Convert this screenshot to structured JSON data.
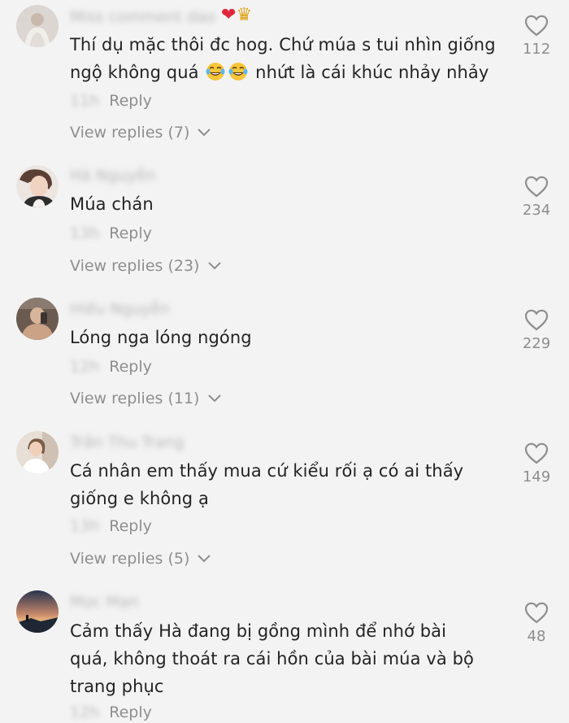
{
  "comments": [
    {
      "username": "Miss comment dao",
      "badges": {
        "heart": "❤",
        "crown": "♛"
      },
      "text_line1": "Thí dụ mặc thôi đc hog. Chứ múa s tui nhìn giống",
      "text_line2_before": "ngộ không quá",
      "text_line2_after": "nhứt là cái khúc nhảy nhảy",
      "emoji": "tears-of-joy",
      "timestamp": "11h",
      "reply_label": "Reply",
      "view_replies": "View replies (7)",
      "likes": "112"
    },
    {
      "username": "Hà Nguyễn",
      "text": "Múa chán",
      "timestamp": "13h",
      "reply_label": "Reply",
      "view_replies": "View replies (23)",
      "likes": "234"
    },
    {
      "username": "Hiếu Nguyễn",
      "text": "Lóng nga lóng ngóng",
      "timestamp": "12h",
      "reply_label": "Reply",
      "view_replies": "View replies (11)",
      "likes": "229"
    },
    {
      "username": "Trần Thu Trang",
      "text": "Cá nhân em thấy mua cứ kiểu rối ạ có ai thấy giống e không ạ",
      "timestamp": "13h",
      "reply_label": "Reply",
      "view_replies": "View replies (5)",
      "likes": "149"
    },
    {
      "username": "Mọc Mạn",
      "text": "Cảm thấy Hà đang bị gồng mình để nhớ bài quá, không thoát ra cái hồn của bài múa và bộ trang phục",
      "timestamp": "12h",
      "reply_label": "Reply",
      "likes": "48"
    }
  ],
  "colors": {
    "background": "#f3f3f3",
    "text": "#232323",
    "muted": "#8e8e8e",
    "heart": "#e0283c"
  },
  "icons": {
    "like": "heart-outline-icon",
    "expand": "chevron-down-icon"
  }
}
